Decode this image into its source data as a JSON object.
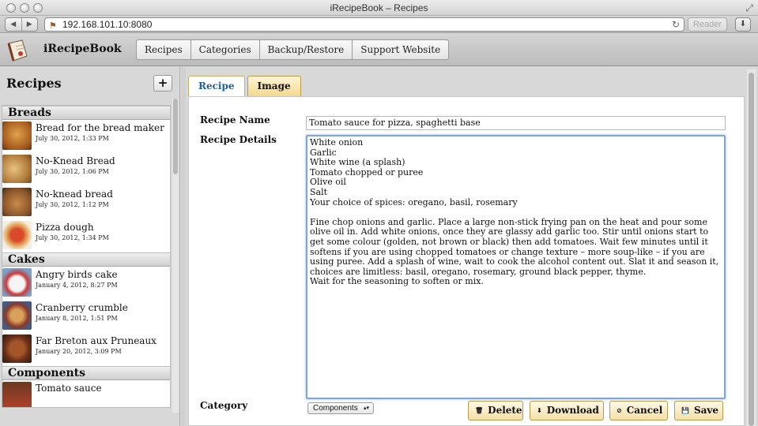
{
  "window": {
    "title": "iRecipeBook – Recipes"
  },
  "browser": {
    "url": "192.168.101.10:8080",
    "reader_label": "Reader"
  },
  "app": {
    "name": "iRecipeBook",
    "nav": [
      "Recipes",
      "Categories",
      "Backup/Restore",
      "Support Website"
    ]
  },
  "sidebar": {
    "title": "Recipes",
    "add_label": "+",
    "sections": [
      {
        "name": "Breads",
        "items": [
          {
            "name": "Bread for the bread maker",
            "date": "July 30, 2012, 1:33 PM"
          },
          {
            "name": "No-Knead Bread",
            "date": "July 30, 2012, 1:06 PM"
          },
          {
            "name": "No-knead bread",
            "date": "July 30, 2012, 1:12 PM"
          },
          {
            "name": "Pizza dough",
            "date": "July 30, 2012, 1:34 PM"
          }
        ]
      },
      {
        "name": "Cakes",
        "items": [
          {
            "name": "Angry birds cake",
            "date": "January 4, 2012, 8:27 PM"
          },
          {
            "name": "Cranberry crumble",
            "date": "January 8, 2012, 1:51 PM"
          },
          {
            "name": "Far Breton aux Pruneaux",
            "date": "January 20, 2012, 3:09 PM"
          }
        ]
      },
      {
        "name": "Components",
        "items": [
          {
            "name": "Tomato sauce",
            "date": ""
          }
        ]
      }
    ]
  },
  "tabs": [
    "Recipe",
    "Image"
  ],
  "form": {
    "name_label": "Recipe Name",
    "name_value": "Tomato sauce for pizza, spaghetti base",
    "details_label": "Recipe Details",
    "details_value": "White onion\nGarlic\nWhite wine (a splash)\nTomato chopped or puree\nOlive oil\nSalt\nYour choice of spices: oregano, basil, rosemary\n\nFine chop onions and garlic. Place a large non-stick frying pan on the heat and pour some olive oil in. Add white onions, once they are glassy add garlic too. Stir until onions start to get some colour (golden, not brown or black) then add tomatoes. Wait few minutes until it softens if you are using chopped tomatoes or change texture – more soup-like – if you are using puree. Add a splash of wine, wait to cook the alcohol content out. Slat it and season it, choices are limitless: basil, oregano, rosemary, ground black pepper, thyme.\nWait for the seasoning to soften or mix.",
    "category_label": "Category",
    "category_value": "Components"
  },
  "actions": {
    "delete": "Delete",
    "download": "Download",
    "cancel": "Cancel",
    "save": "Save"
  }
}
